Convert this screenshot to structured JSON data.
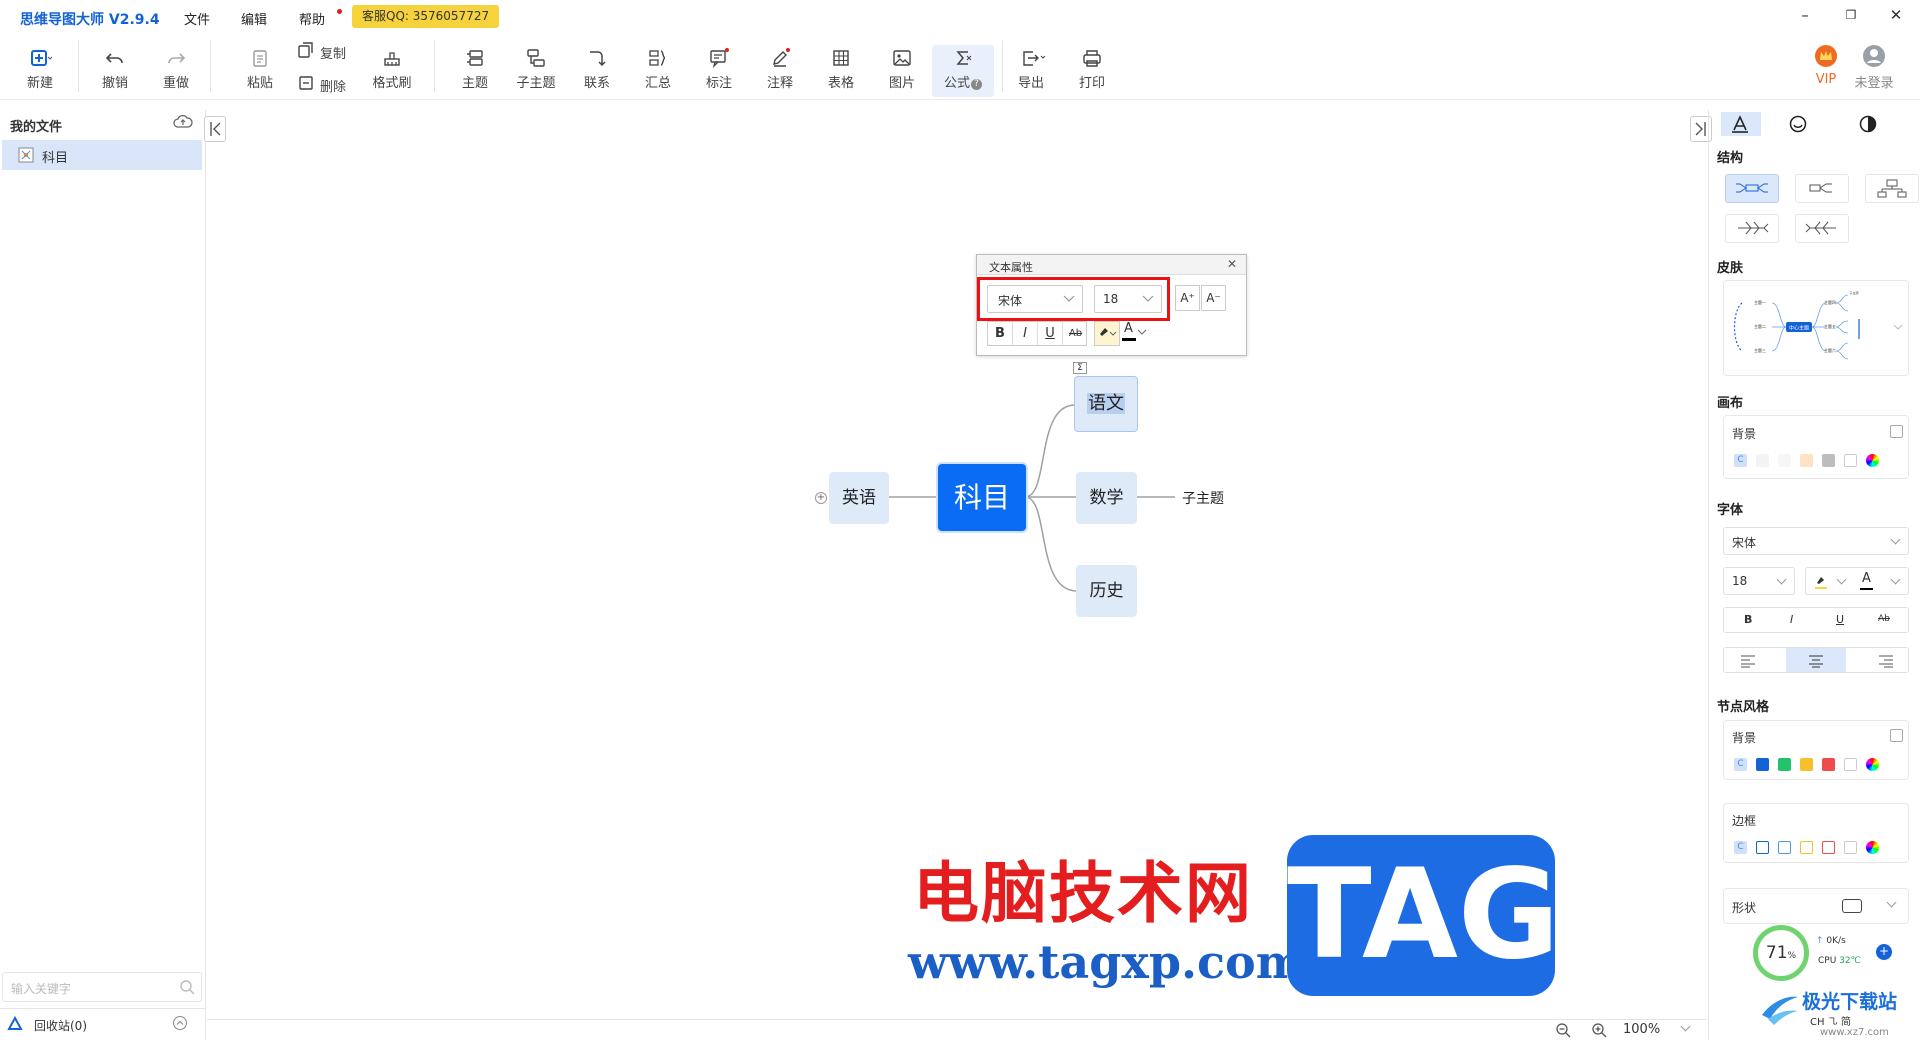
{
  "app": {
    "title": "思维导图大师 V2.9.4",
    "menu": [
      "文件",
      "编辑",
      "帮助"
    ],
    "qq": "客服QQ: 3576057727"
  },
  "toolbar": {
    "new": "新建",
    "undo": "撤销",
    "redo": "重做",
    "paste": "粘贴",
    "copy": "复制",
    "delete": "删除",
    "format_brush": "格式刷",
    "topic": "主题",
    "subtopic": "子主题",
    "relation": "联系",
    "summary": "汇总",
    "marker": "标注",
    "note": "注释",
    "table": "表格",
    "image": "图片",
    "formula": "公式",
    "export": "导出",
    "print": "打印",
    "vip": "VIP",
    "login": "未登录"
  },
  "sidebar": {
    "title": "我的文件",
    "files": [
      "科目"
    ],
    "search_placeholder": "输入关键字",
    "recycle": "回收站(0)"
  },
  "mindmap": {
    "center": "科目",
    "nodes": {
      "chinese": "语文",
      "english": "英语",
      "math": "数学",
      "history": "历史",
      "subtopic": "子主题"
    }
  },
  "text_dialog": {
    "title": "文本属性",
    "font": "宋体",
    "size": "18",
    "bold": "B",
    "italic": "I",
    "underline": "U",
    "strike": "Ab",
    "grow": "A⁺",
    "shrink": "A⁻"
  },
  "right_panel": {
    "structure": "结构",
    "skin": "皮肤",
    "canvas": "画布",
    "background": "背景",
    "font_section": "字体",
    "font": "宋体",
    "size": "18",
    "node_style": "节点风格",
    "node_background": "背景",
    "border": "边框",
    "shape": "形状",
    "skin_preview": {
      "center": "中心主题",
      "t1": "主题一",
      "t2": "主题二",
      "t3": "主题三",
      "t4": "主题四",
      "t5": "主题五",
      "t6": "主题六",
      "sub": "子主题"
    }
  },
  "status": {
    "zoom": "100%"
  },
  "overlay": {
    "cpu_percent": "71",
    "cpu_unit": "%",
    "net": "0K/s",
    "cpu_label": "CPU",
    "cpu_temp": "32℃",
    "ime": "CH ㇈ 简"
  },
  "watermark": {
    "cn": "电脑技术网",
    "url": "www.tagxp.com",
    "tag": "TAG",
    "site": "极光下载站",
    "site_url": "www.xz7.com"
  },
  "colors": {
    "accent": "#1463d6",
    "center_node": "#0a6cf5",
    "branch_node": "#dfeaf9",
    "highlight": "#e11"
  }
}
